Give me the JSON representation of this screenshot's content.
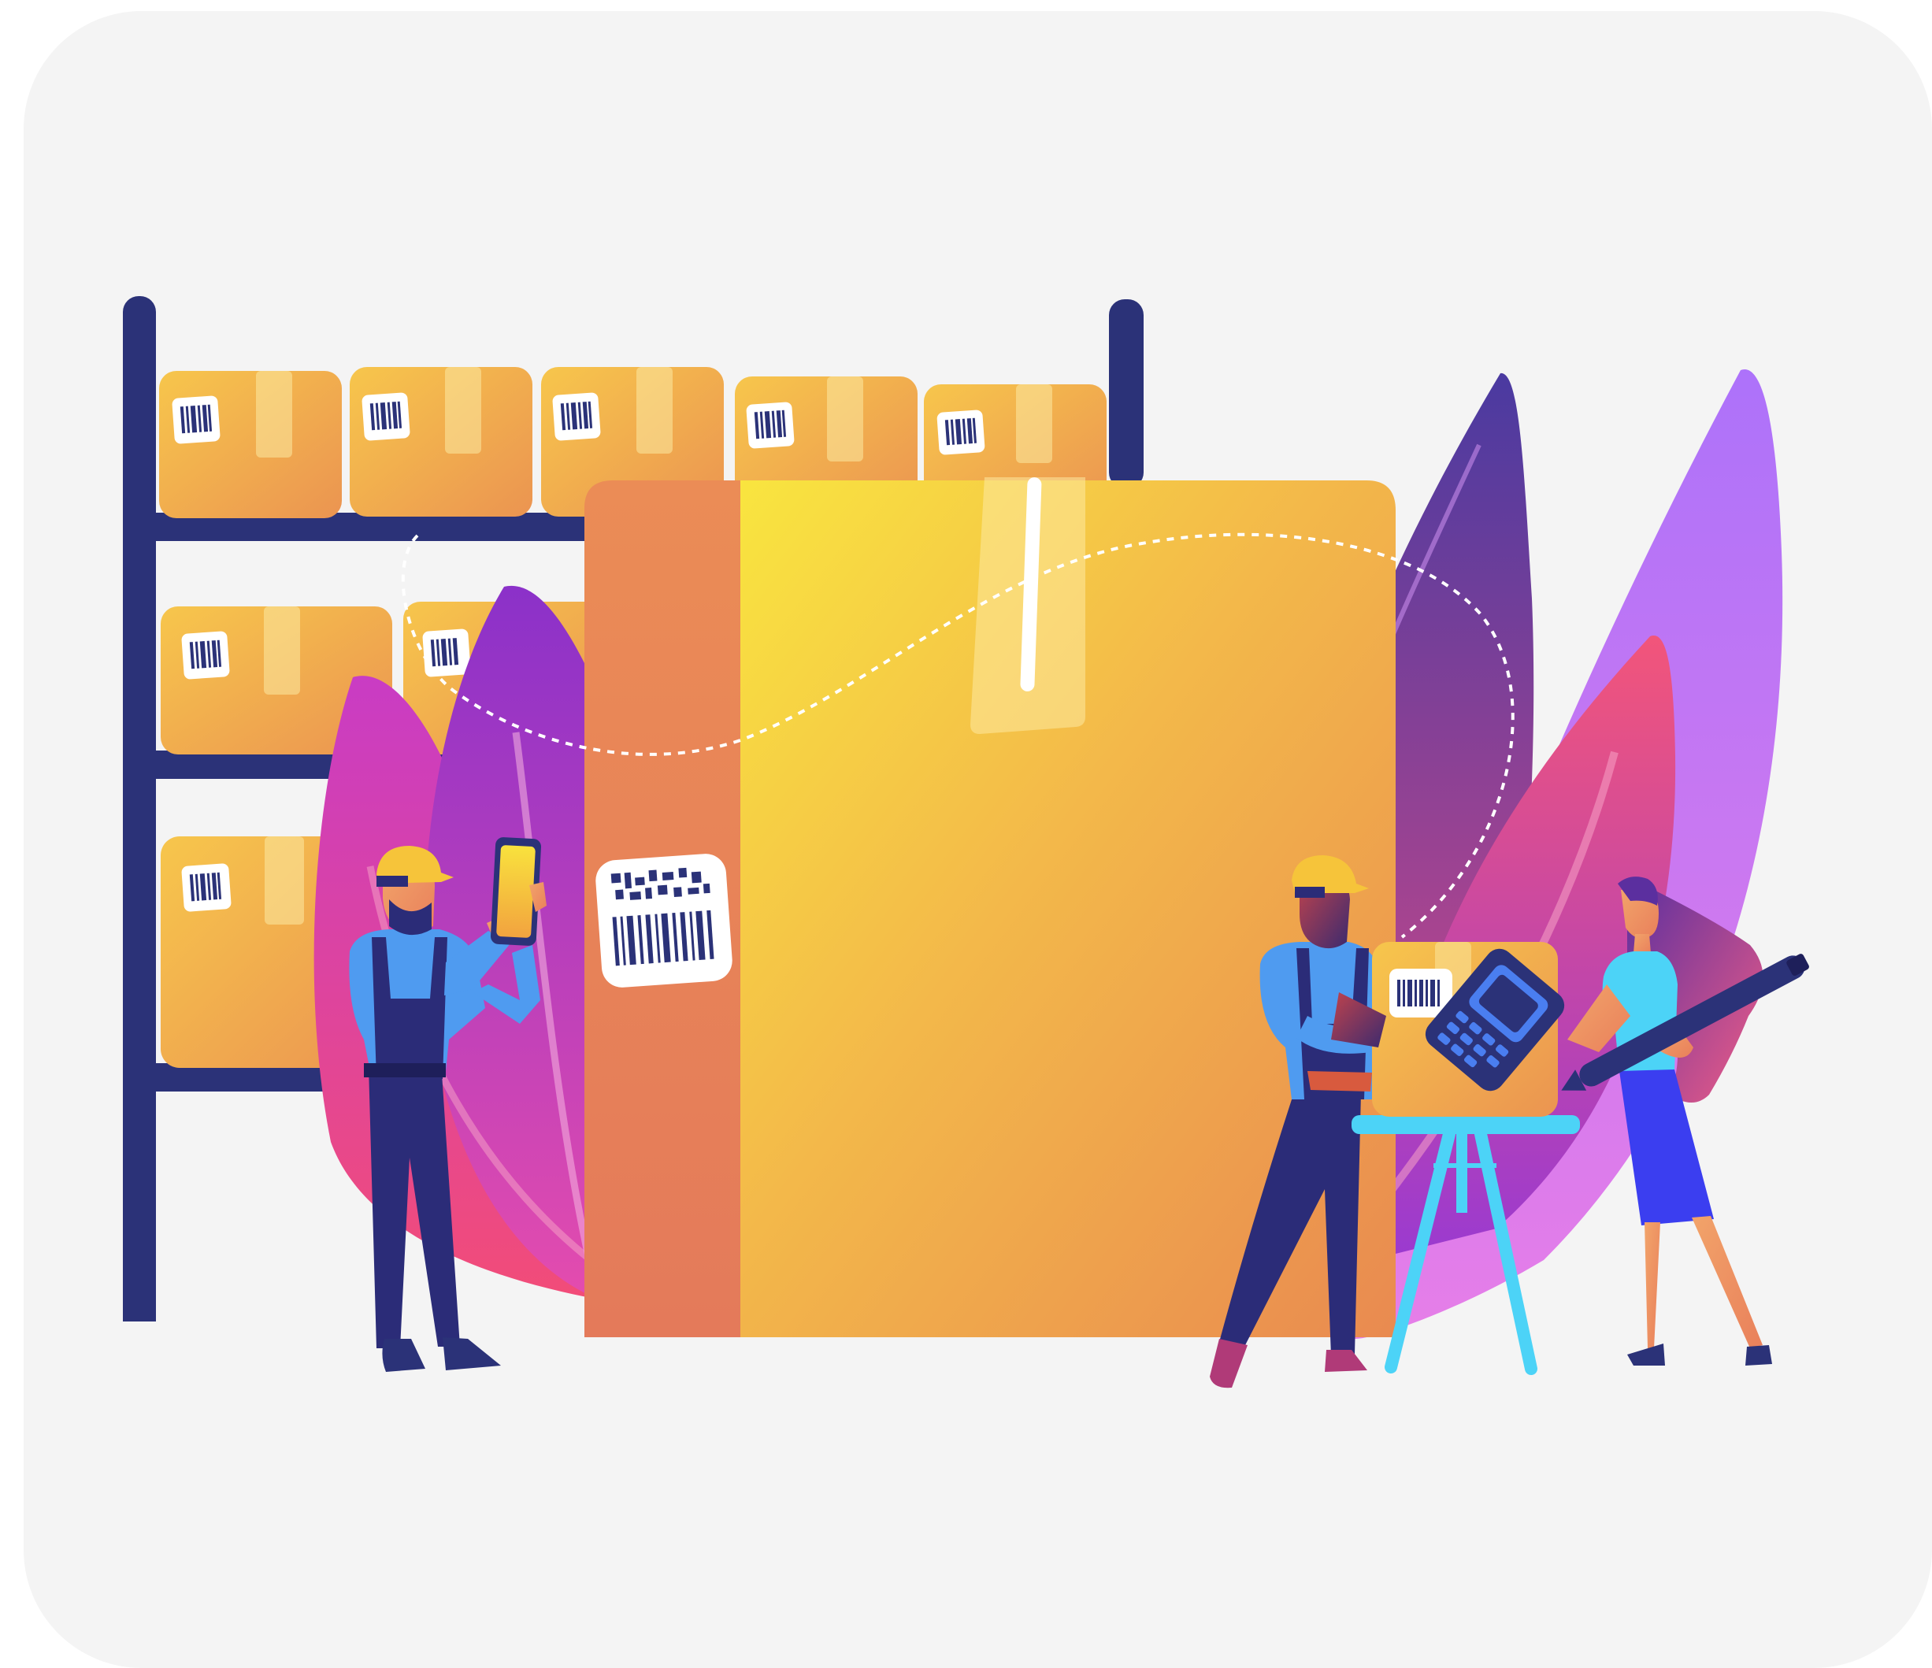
{
  "colors": {
    "background": "#f4f4f4",
    "rack": "#2b3278",
    "box_light": "#f6c24b",
    "box_dark": "#e98a51",
    "leaf_purple": "#8b34c9",
    "leaf_pink": "#ee4b7c",
    "leaf_lilac": "#b67cf6",
    "worker_shirt": "#4f9bf0",
    "worker_overalls": "#2b2c78",
    "hard_hat": "#f6c43a",
    "cyan": "#4cd3f7"
  },
  "icons": [
    "barcode-icon",
    "qr-code-icon",
    "handheld-scanner-icon",
    "tablet-icon",
    "stylus-pen-icon"
  ]
}
